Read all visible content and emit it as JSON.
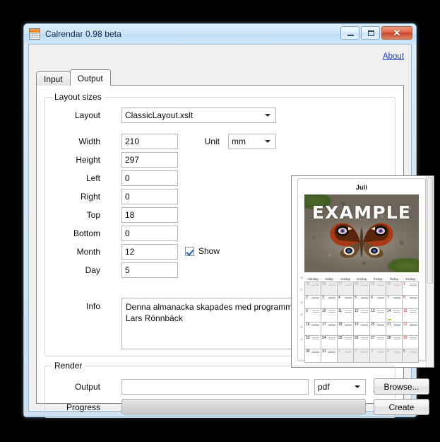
{
  "window": {
    "title": "Calrendar 0.98 beta",
    "icon": "calendar-icon",
    "buttons": {
      "minimize": "–",
      "maximize": "▫",
      "close": "✕"
    }
  },
  "about_link": "About",
  "tabs": [
    {
      "label": "Input",
      "active": false
    },
    {
      "label": "Output",
      "active": true
    }
  ],
  "layout_group": {
    "title": "Layout sizes",
    "layout_label": "Layout",
    "layout_value": "ClassicLayout.xslt",
    "unit_label": "Unit",
    "unit_value": "mm",
    "fields": [
      {
        "label": "Width",
        "value": "210"
      },
      {
        "label": "Height",
        "value": "297"
      },
      {
        "label": "Left",
        "value": "0"
      },
      {
        "label": "Right",
        "value": "0"
      },
      {
        "label": "Top",
        "value": "18"
      },
      {
        "label": "Bottom",
        "value": "0"
      },
      {
        "label": "Month",
        "value": "12"
      },
      {
        "label": "Day",
        "value": "5"
      }
    ],
    "show_checkbox_label": "Show",
    "show_checkbox_checked": true,
    "info_label": "Info",
    "info_value": "Denna almanacka skapades med programmet Calrendar skrivet av Lars Rönnbäck"
  },
  "render_group": {
    "title": "Render",
    "output_label": "Output",
    "output_value": "",
    "format_value": "pdf",
    "browse_label": "Browse...",
    "progress_label": "Progress",
    "progress_percent": 0,
    "create_label": "Create"
  },
  "preview": {
    "month_title": "Juli",
    "watermark": "EXAMPLE",
    "photo_alt": "peacock-butterfly-on-rock",
    "weekdays": [
      "måndag",
      "tisdag",
      "onsdag",
      "torsdag",
      "fredag",
      "lördag",
      "söndag"
    ],
    "week_numbers": [
      "26",
      "27",
      "28",
      "29",
      "30",
      "31"
    ],
    "weeks": [
      [
        {
          "d": "25",
          "other": true
        },
        {
          "d": "26",
          "other": true
        },
        {
          "d": "27",
          "other": true
        },
        {
          "d": "28",
          "other": true
        },
        {
          "d": "29",
          "other": true
        },
        {
          "d": "30",
          "other": true
        },
        {
          "d": "1",
          "sunday": true
        }
      ],
      [
        {
          "d": "2"
        },
        {
          "d": "3"
        },
        {
          "d": "4"
        },
        {
          "d": "5"
        },
        {
          "d": "6"
        },
        {
          "d": "7"
        },
        {
          "d": "8",
          "sunday": true
        }
      ],
      [
        {
          "d": "9"
        },
        {
          "d": "10"
        },
        {
          "d": "11"
        },
        {
          "d": "12"
        },
        {
          "d": "13"
        },
        {
          "d": "14",
          "marked": true
        },
        {
          "d": "15",
          "sunday": true
        }
      ],
      [
        {
          "d": "16"
        },
        {
          "d": "17"
        },
        {
          "d": "18"
        },
        {
          "d": "19"
        },
        {
          "d": "20"
        },
        {
          "d": "21"
        },
        {
          "d": "22",
          "sunday": true
        }
      ],
      [
        {
          "d": "23"
        },
        {
          "d": "24"
        },
        {
          "d": "25"
        },
        {
          "d": "26"
        },
        {
          "d": "27"
        },
        {
          "d": "28"
        },
        {
          "d": "29",
          "sunday": true
        }
      ],
      [
        {
          "d": "30"
        },
        {
          "d": "31"
        },
        {
          "d": "1",
          "other": true
        },
        {
          "d": "2",
          "other": true
        },
        {
          "d": "3",
          "other": true
        },
        {
          "d": "4",
          "other": true
        },
        {
          "d": "5",
          "other": true,
          "sunday": true
        }
      ]
    ]
  },
  "colors": {
    "accent_link": "#1c3fbf",
    "title_bar": "#cfe6f8",
    "close_button": "#c7452b",
    "sunday_text": "#d01b1b",
    "page_background": "#ffffff",
    "desktop": "#000000"
  }
}
